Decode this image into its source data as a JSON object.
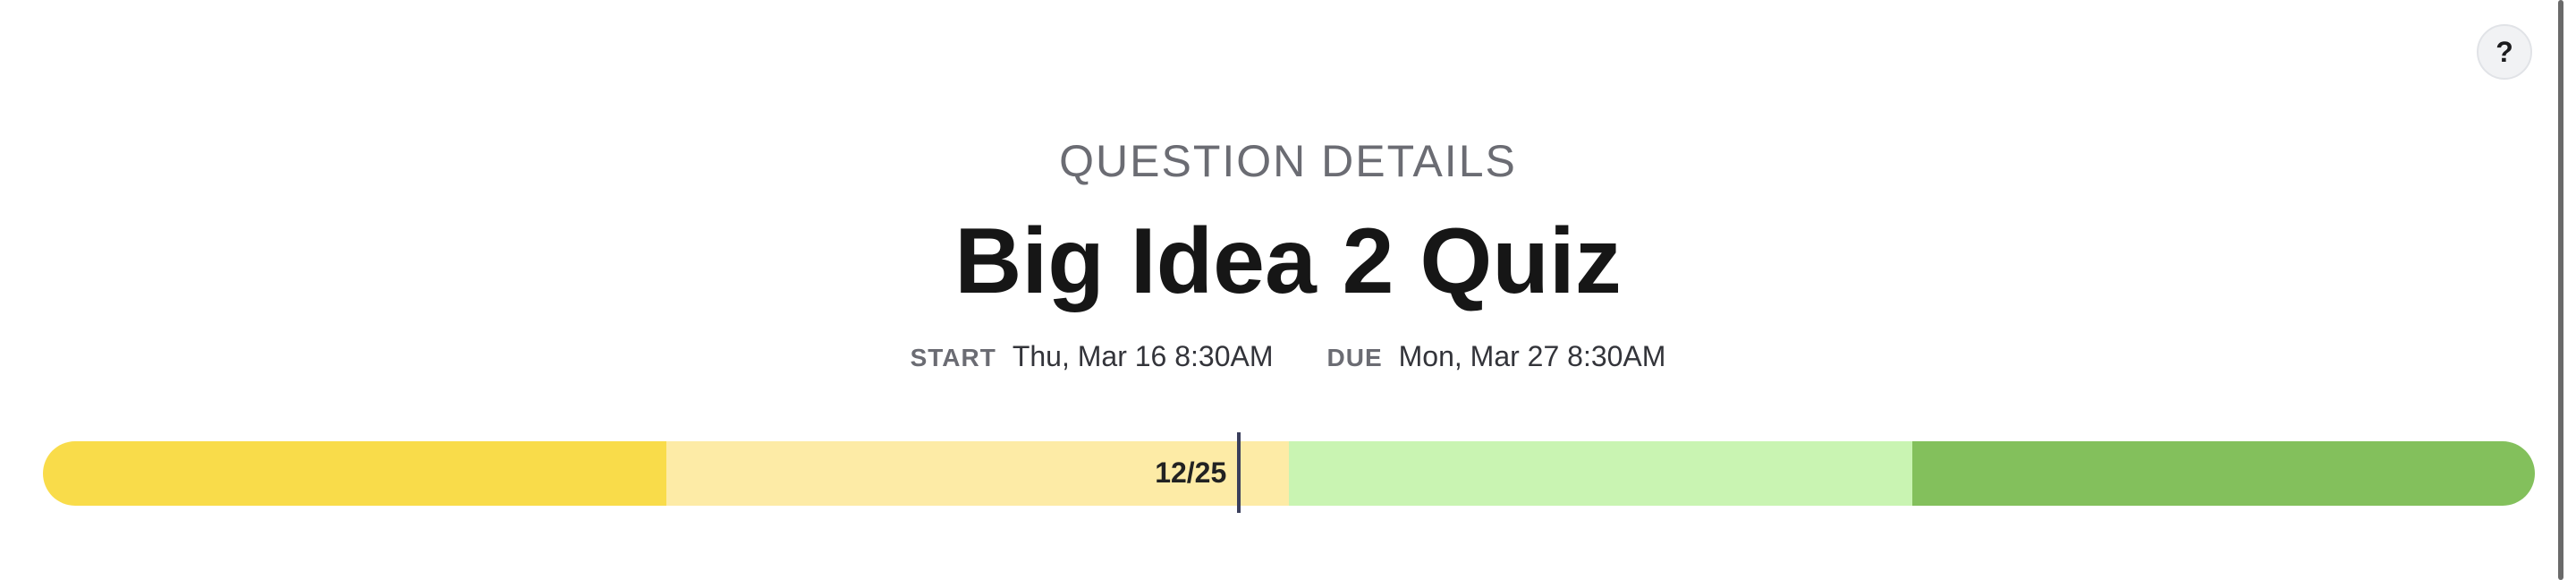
{
  "help": {
    "label": "?",
    "icon": "help-icon"
  },
  "header": {
    "subtitle": "QUESTION DETAILS",
    "title": "Big Idea 2 Quiz"
  },
  "dates": {
    "start_label": "START",
    "start_value": "Thu, Mar 16 8:30AM",
    "due_label": "DUE",
    "due_value": "Mon, Mar 27 8:30AM"
  },
  "progress": {
    "label": "12/25",
    "current": 12,
    "total": 25,
    "segment_colors": [
      "#f9dc4a",
      "#fdeba6",
      "#c9f4b2",
      "#83c05c"
    ],
    "marker_color": "#3a3f5c"
  }
}
